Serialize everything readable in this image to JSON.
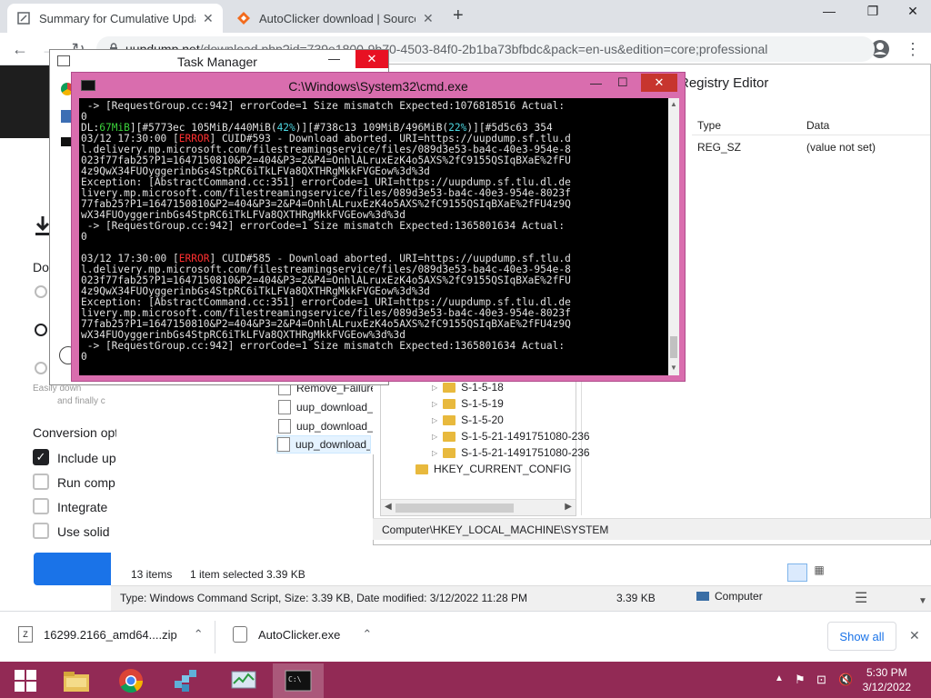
{
  "browser": {
    "tabs": [
      {
        "title": "Summary for Cumulative Update",
        "icon": "page-icon"
      },
      {
        "title": "AutoClicker download | SourceForge",
        "icon": "sourceforge-icon"
      }
    ],
    "url_host": "uupdump.net",
    "url_path": "/download.php?id=739e1800-9b70-4503-84f0-2b1ba73bfbdc&pack=en-us&edition=core;professional"
  },
  "page": {
    "do_label": "Do",
    "easily_text": "Easily down",
    "finally_text": "and finally c",
    "conversion_heading": "Conversion opt",
    "options": [
      {
        "label": "Include up",
        "checked": true
      },
      {
        "label": "Run comp",
        "checked": false
      },
      {
        "label": "Integrate",
        "checked": false
      },
      {
        "label": "Use solid",
        "checked": false
      }
    ]
  },
  "task_manager": {
    "title": "Task Manager"
  },
  "cmd": {
    "title": "C:\\Windows\\System32\\cmd.exe",
    "lines": [
      " -> [RequestGroup.cc:942] errorCode=1 Size mismatch Expected:1076818516 Actual:",
      "0",
      "DL:67MiB][#5773ec 105MiB/440MiB(42%)][#738c13 109MiB/496MiB(22%)][#5d5c63 354",
      "03/12 17:30:00 [ERROR] CUID#593 - Download aborted. URI=https://uupdump.sf.tlu.d",
      "l.delivery.mp.microsoft.com/filestreamingservice/files/089d3e53-ba4c-40e3-954e-8",
      "023f77fab25?P1=1647150810&P2=404&P3=2&P4=OnhlALruxEzK4o5AXS%2fC9155QSIqBXaE%2fFU",
      "4z9QwX34FUOyggerinbGs4StpRC6iTkLFVa8QXTHRgMkkFVGEow%3d%3d",
      "Exception: [AbstractCommand.cc:351] errorCode=1 URI=https://uupdump.sf.tlu.dl.de",
      "livery.mp.microsoft.com/filestreamingservice/files/089d3e53-ba4c-40e3-954e-8023f",
      "77fab25?P1=1647150810&P2=404&P3=2&P4=OnhlALruxEzK4o5AXS%2fC9155QSIqBXaE%2fFU4z9Q",
      "wX34FUOyggerinbGs4StpRC6iTkLFVa8QXTHRgMkkFVGEow%3d%3d",
      " -> [RequestGroup.cc:942] errorCode=1 Size mismatch Expected:1365801634 Actual:",
      "0",
      "",
      "03/12 17:30:00 [ERROR] CUID#585 - Download aborted. URI=https://uupdump.sf.tlu.d",
      "l.delivery.mp.microsoft.com/filestreamingservice/files/089d3e53-ba4c-40e3-954e-8",
      "023f77fab25?P1=1647150810&P2=404&P3=2&P4=OnhlALruxEzK4o5AXS%2fC9155QSIqBXaE%2fFU",
      "4z9QwX34FUOyggerinbGs4StpRC6iTkLFVa8QXTHRgMkkFVGEow%3d%3d",
      "Exception: [AbstractCommand.cc:351] errorCode=1 URI=https://uupdump.sf.tlu.dl.de",
      "livery.mp.microsoft.com/filestreamingservice/files/089d3e53-ba4c-40e3-954e-8023f",
      "77fab25?P1=1647150810&P2=404&P3=2&P4=OnhlALruxEzK4o5AXS%2fC9155QSIqBXaE%2fFU4z9Q",
      "wX34FUOyggerinbGs4StpRC6iTkLFVa8QXTHRgMkkFVGEow%3d%3d",
      " -> [RequestGroup.cc:942] errorCode=1 Size mismatch Expected:1365801634 Actual:",
      "0"
    ]
  },
  "regedit": {
    "title": "Registry Editor",
    "col_type": "Type",
    "col_data": "Data",
    "row_type": "REG_SZ",
    "row_data": "(value not set)",
    "tree": [
      "S-1-5-18",
      "S-1-5-19",
      "S-1-5-20",
      "S-1-5-21-1491751080-236",
      "S-1-5-21-1491751080-236"
    ],
    "hkcc": "HKEY_CURRENT_CONFIG",
    "path": "Computer\\HKEY_LOCAL_MACHINE\\SYSTEM"
  },
  "explorer": {
    "files": [
      "Remove_Failure",
      "uup_download_",
      "uup_download_",
      "uup_download_"
    ],
    "item_count": "13 items",
    "selected": "1 item selected  3.39 KB",
    "details": "Type: Windows Command Script, Size: 3.39 KB, Date modified: 3/12/2022 11:28 PM",
    "size": "3.39 KB",
    "location": "Computer"
  },
  "downloads": {
    "items": [
      "16299.2166_amd64....zip",
      "AutoClicker.exe"
    ],
    "show_all": "Show all"
  },
  "taskbar": {
    "time": "5:30 PM",
    "date": "3/12/2022"
  },
  "colors": {
    "cmd_frame": "#d96dae",
    "taskbar": "#922a55"
  }
}
